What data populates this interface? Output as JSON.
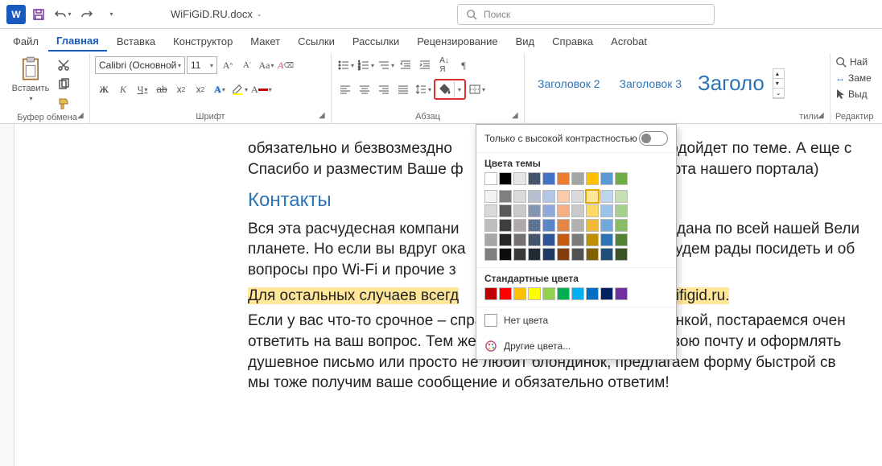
{
  "title": {
    "doc_name": "WiFiGiD.RU.docx"
  },
  "qat": {
    "save": "save-icon",
    "undo": "undo-icon",
    "redo": "redo-icon"
  },
  "search": {
    "placeholder": "Поиск"
  },
  "tabs": [
    "Файл",
    "Главная",
    "Вставка",
    "Конструктор",
    "Макет",
    "Ссылки",
    "Рассылки",
    "Рецензирование",
    "Вид",
    "Справка",
    "Acrobat"
  ],
  "active_tab": 1,
  "clipboard": {
    "paste": "Вставить",
    "label": "Буфер обмена"
  },
  "font": {
    "name": "Calibri (Основной",
    "size": "11",
    "label": "Шрифт"
  },
  "paragraph": {
    "label": "Абзац"
  },
  "styles": {
    "label": "тили",
    "items": [
      "Заголовок 2",
      "Заголовок 3",
      "Заголо"
    ]
  },
  "editing": {
    "label": "Редактир",
    "find": "Най",
    "replace": "Заме",
    "select": "Выд"
  },
  "popup": {
    "high_contrast": "Только с высокой контрастностью",
    "theme_colors": "Цвета темы",
    "standard_colors": "Стандартные цвета",
    "no_color": "Нет цвета",
    "more_colors": "Другие цвета...",
    "theme_row1": [
      "#FFFFFF",
      "#000000",
      "#E7E6E6",
      "#44546A",
      "#4472C4",
      "#ED7D31",
      "#A5A5A5",
      "#FFC000",
      "#5B9BD5",
      "#70AD47"
    ],
    "theme_shades": [
      [
        "#F2F2F2",
        "#808080",
        "#DADADA",
        "#B6C0D1",
        "#B4C6E7",
        "#F8CBAD",
        "#DBDBDB",
        "#FFE699",
        "#BDD6EE",
        "#C5E0B3"
      ],
      [
        "#D9D9D9",
        "#595959",
        "#C9C9C9",
        "#8496B0",
        "#8EAADB",
        "#F4B083",
        "#C9C9C9",
        "#FFD965",
        "#9CC2E5",
        "#A8D08D"
      ],
      [
        "#BFBFBF",
        "#404040",
        "#AEAAAA",
        "#5E7394",
        "#5B86C9",
        "#E2864A",
        "#B0B0B0",
        "#F1B93A",
        "#73A9D9",
        "#86BC62"
      ],
      [
        "#A6A6A6",
        "#262626",
        "#757171",
        "#44546A",
        "#2F5496",
        "#C55A11",
        "#7B7B7B",
        "#BF8F00",
        "#2E74B5",
        "#538135"
      ],
      [
        "#7F7F7F",
        "#0D0D0D",
        "#3A3838",
        "#222A35",
        "#1F3864",
        "#833C0C",
        "#525252",
        "#806000",
        "#1F4E79",
        "#385623"
      ]
    ],
    "theme_selected": "#FFE699",
    "standard": [
      "#C00000",
      "#FF0000",
      "#FFC000",
      "#FFFF00",
      "#92D050",
      "#00B050",
      "#00B0F0",
      "#0070C0",
      "#002060",
      "#7030A0"
    ]
  },
  "document": {
    "p1": "обязательно и безвозмездно",
    "p1b": "подойдет по теме. А еще с",
    "p2": "Спасибо и разместим Ваше ф",
    "p2b": "рта нашего портала)",
    "h_contacts": "Контакты",
    "p3a": "Вся эта расчудесная компани",
    "p3b": "идана по всей нашей Вели",
    "p4a": "планете. Но если вы вдруг ока",
    "p4b": "будем рады посидеть и об",
    "p5": "вопросы про Wi-Fi и прочие з",
    "hl_a": "Для остальных случаев всегд",
    "hl_b": "wifigid.ru.",
    "p6": "Если у вас что-то срочное – справа внизу есть чат с Блондинкой, постараемся очен",
    "p7": "ответить на ваш вопрос. Тем же, кто не хочет заходить на свою почту и оформлять",
    "p8": "душевное письмо или просто не любит блондинок, предлагаем форму быстрой св",
    "p9": "мы тоже получим ваше сообщение и обязательно ответим!"
  }
}
